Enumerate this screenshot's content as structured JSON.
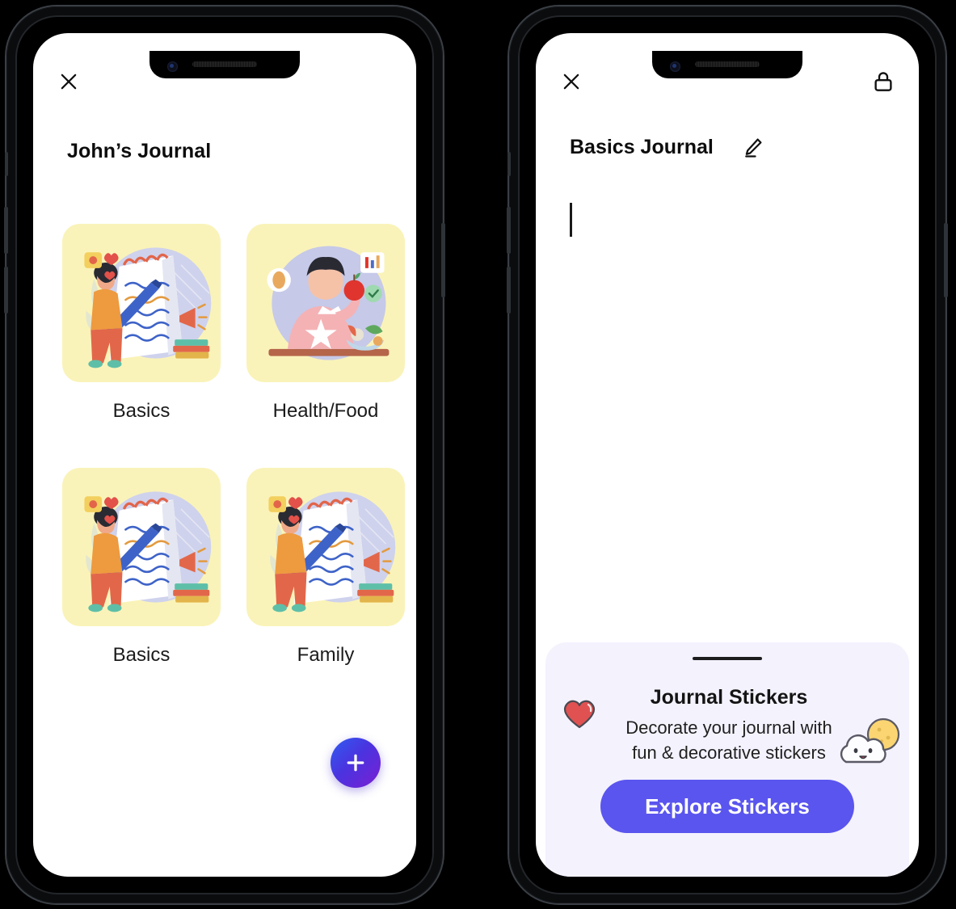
{
  "colors": {
    "card_yellow": "#FAF3B9",
    "sheet_bg": "#F4F2FD",
    "accent_button": "#5A55EE",
    "fab_gradient_start": "#2F5CF0",
    "fab_gradient_end": "#7A1FD2",
    "heart_red": "#E05252",
    "moon_yellow": "#FBD572",
    "text_primary": "#0D0D0D"
  },
  "left_phone": {
    "topbar": {
      "close_icon": "close-icon",
      "close_label": "Close"
    },
    "title": "John’s Journal",
    "journals": [
      {
        "label": "Basics",
        "thumb": "writer-notepad-illustration"
      },
      {
        "label": "Health/Food",
        "thumb": "healthy-eating-illustration"
      },
      {
        "label": "Basics",
        "thumb": "writer-notepad-illustration"
      },
      {
        "label": "Family",
        "thumb": "writer-notepad-illustration"
      }
    ],
    "fab": {
      "icon": "plus-icon",
      "label": "Add journal"
    }
  },
  "right_phone": {
    "topbar": {
      "close_icon": "close-icon",
      "lock_icon": "lock-icon"
    },
    "journal_title": "Basics Journal",
    "edit_icon": "pencil-edit-icon",
    "editor": {
      "value": "",
      "placeholder": ""
    },
    "sticker_sheet": {
      "handle": "drag-handle",
      "title": "Journal Stickers",
      "subtitle_line1": "Decorate your journal with",
      "subtitle_line2": "fun & decorative stickers",
      "heart_sticker": "heart-sticker",
      "cloud_sticker": "cloud-moon-sticker",
      "cta_label": "Explore Stickers"
    }
  }
}
